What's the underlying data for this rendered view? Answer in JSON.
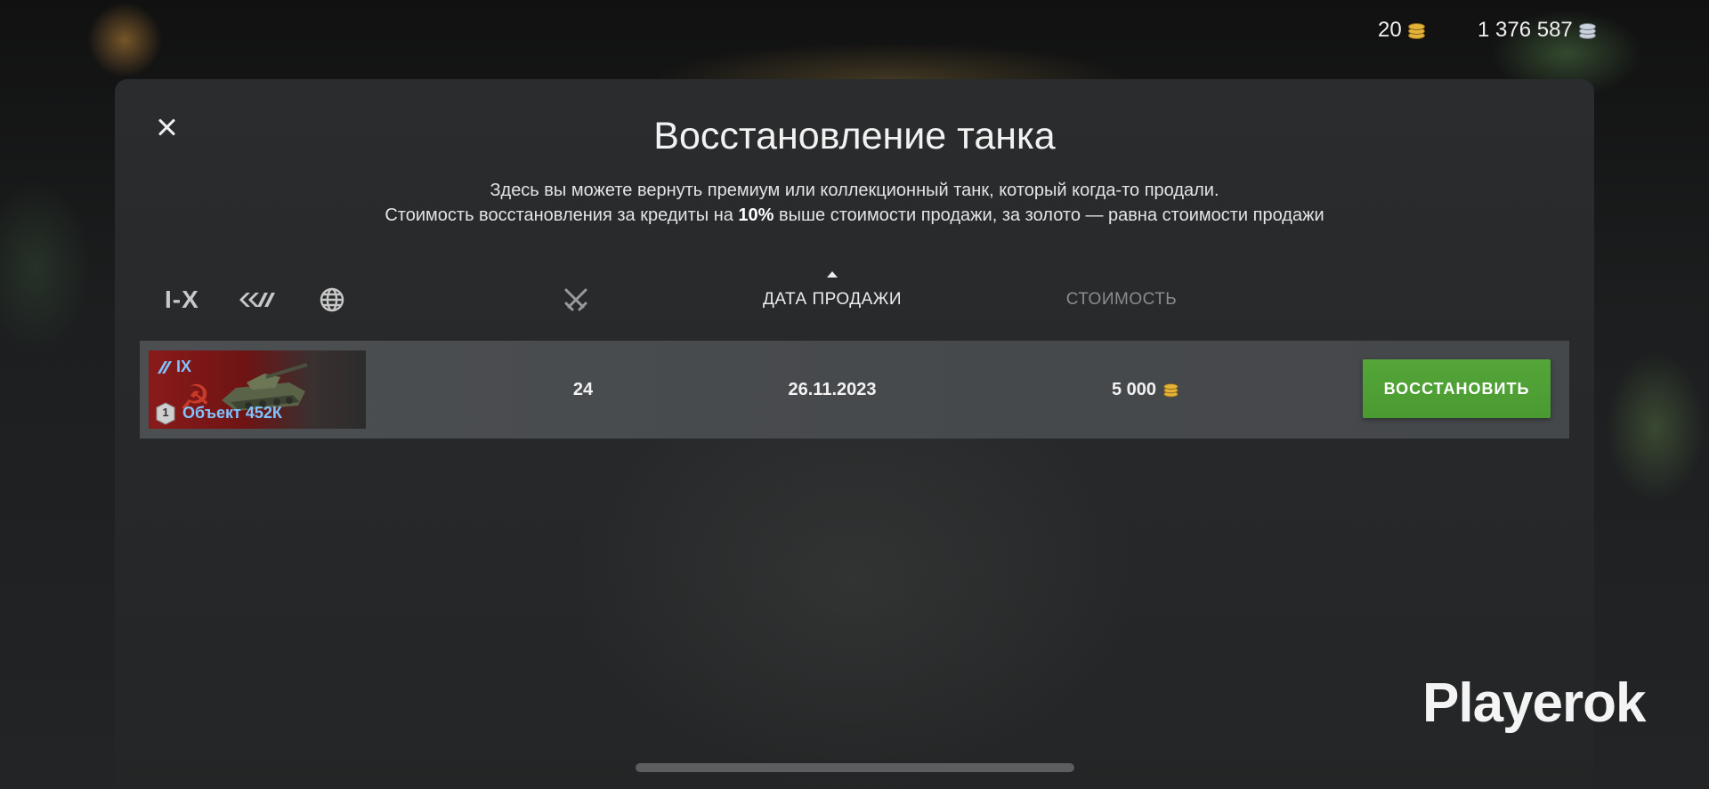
{
  "currency": {
    "gold": "20",
    "silver": "1 376 587",
    "gold_icon": "gold-coins-icon",
    "silver_icon": "silver-coins-icon"
  },
  "dialog": {
    "title": "Восстановление танка",
    "description_line1": "Здесь вы можете вернуть премиум или коллекционный танк, который когда-то продали.",
    "description_line2_before": "Стоимость восстановления за кредиты на ",
    "description_line2_bold": "10%",
    "description_line2_after": " выше стоимости продажи, за золото — равна стоимости продажи",
    "close_icon": "close-icon"
  },
  "filters": {
    "tier_label": "I-X",
    "type_icon": "vehicle-type-icon",
    "nation_icon": "globe-icon"
  },
  "columns": {
    "battles_icon": "crossed-swords-icon",
    "sale_date": "ДАТА ПРОДАЖИ",
    "price": "СТОИМОСТЬ",
    "sort_icon": "sort-ascending-icon"
  },
  "rows": [
    {
      "tier": "IX",
      "tank_name": "Объект 452К",
      "mastery_badge": "1",
      "battles": "24",
      "sale_date": "26.11.2023",
      "price": "5 000",
      "price_icon": "gold-coins-icon",
      "action_label": "ВОССТАНОВИТЬ"
    }
  ],
  "watermark": "Playerok",
  "colors": {
    "accent_green": "#4f9f35",
    "tank_name_blue": "#7fc3ff",
    "gold": "#e2b23a"
  }
}
